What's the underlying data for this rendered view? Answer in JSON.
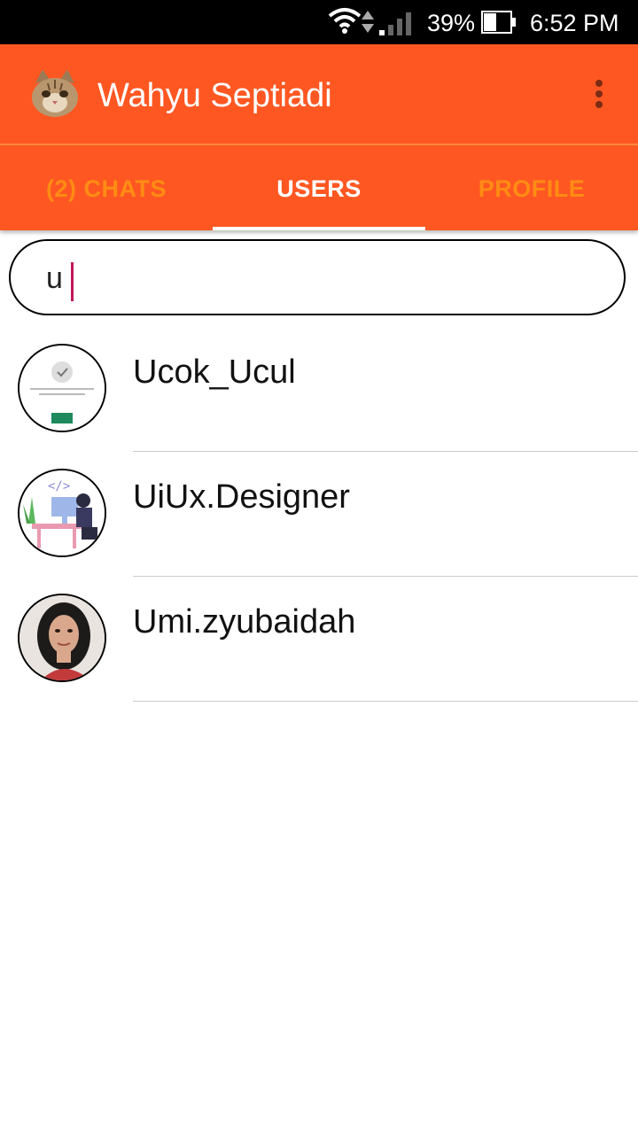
{
  "status_bar": {
    "battery": "39%",
    "time": "6:52 PM",
    "icons": [
      "wifi-icon",
      "data-arrows-icon",
      "signal-icon",
      "battery-icon"
    ]
  },
  "app_bar": {
    "title": "Wahyu Septiadi",
    "avatar": "cat-avatar",
    "menu_icon": "overflow-menu-icon"
  },
  "tabs": [
    {
      "label": "(2) CHATS",
      "active": false
    },
    {
      "label": "USERS",
      "active": true
    },
    {
      "label": "PROFILE",
      "active": false
    }
  ],
  "search": {
    "value": "u"
  },
  "users": [
    {
      "name": "Ucok_Ucul",
      "avatar": "placeholder-avatar"
    },
    {
      "name": "UiUx.Designer",
      "avatar": "designer-illustration-avatar"
    },
    {
      "name": "Umi.zyubaidah",
      "avatar": "woman-photo-avatar"
    }
  ],
  "colors": {
    "primary": "#ff5722",
    "tab_inactive": "#ff8c14",
    "tab_active": "#ffffff",
    "caret": "#c2185b"
  }
}
